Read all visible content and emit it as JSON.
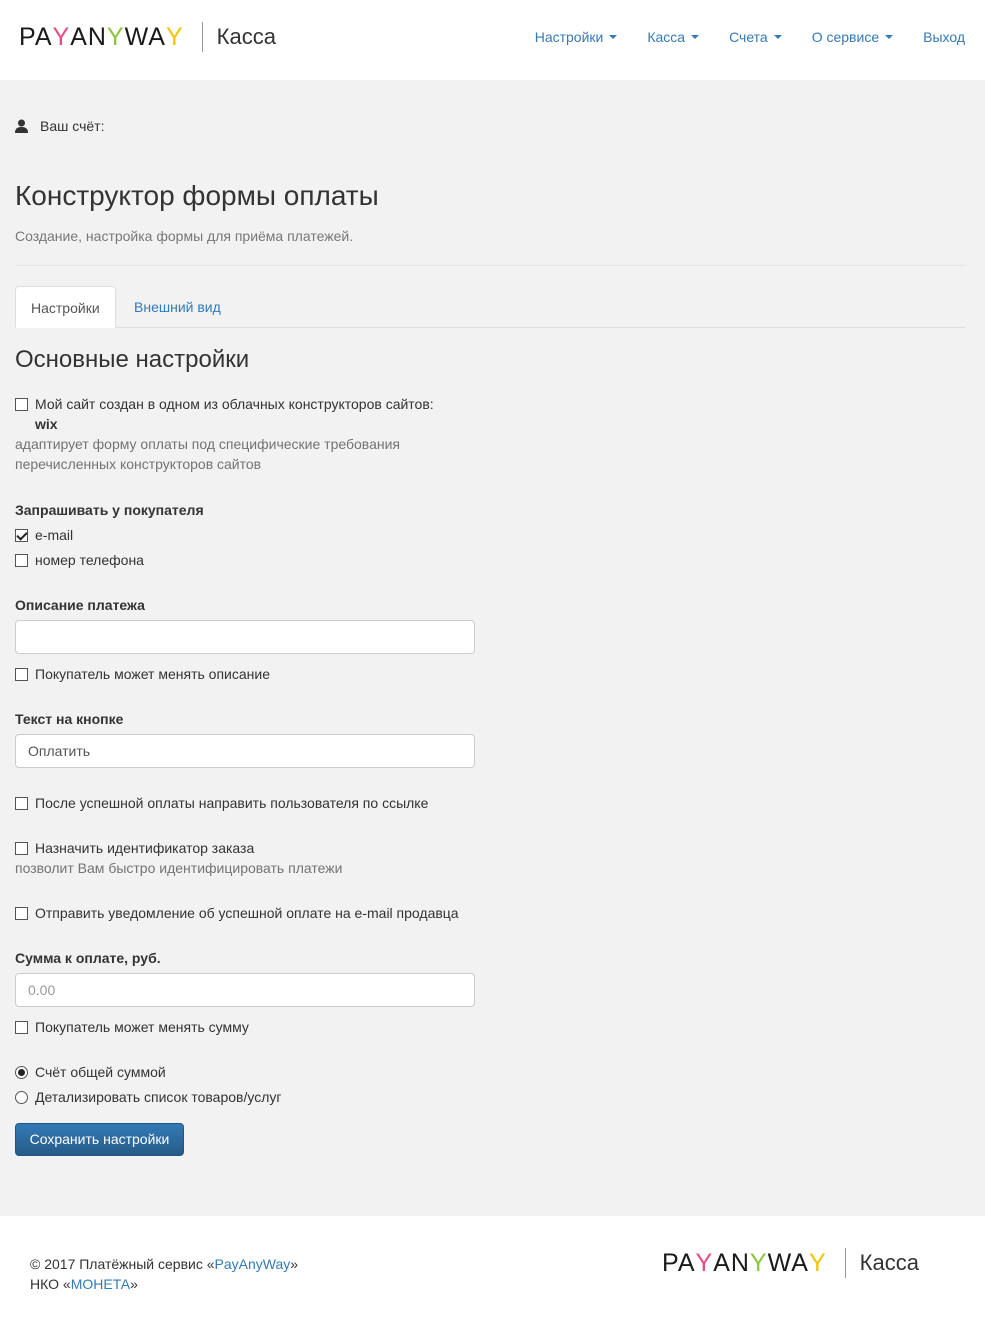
{
  "header": {
    "logo_text": "PAYANYWAY",
    "app_name": "Касса",
    "nav": [
      {
        "label": "Настройки",
        "dropdown": true
      },
      {
        "label": "Касса",
        "dropdown": true
      },
      {
        "label": "Счета",
        "dropdown": true
      },
      {
        "label": "О сервисе",
        "dropdown": true
      },
      {
        "label": "Выход",
        "dropdown": false
      }
    ]
  },
  "account": {
    "label": "Ваш счёт:",
    "icon": "user-icon"
  },
  "page": {
    "title": "Конструктор формы оплаты",
    "subtitle": "Создание, настройка формы для приёма платежей."
  },
  "tabs": [
    {
      "label": "Настройки",
      "active": true
    },
    {
      "label": "Внешний вид",
      "active": false
    }
  ],
  "form": {
    "section_title": "Основные настройки",
    "cloud_builder": {
      "label": "Мой сайт создан в одном из облачных конструкторов сайтов:",
      "option": "wix",
      "help_line1": "адаптирует форму оплаты под специфические требования",
      "help_line2": "перечисленных конструкторов сайтов",
      "checked": false
    },
    "ask_buyer": {
      "label": "Запрашивать у покупателя",
      "email": {
        "label": "e-mail",
        "checked": true
      },
      "phone": {
        "label": "номер телефона",
        "checked": false
      }
    },
    "description": {
      "label": "Описание платежа",
      "value": "",
      "editable_label": "Покупатель может менять описание",
      "editable_checked": false
    },
    "button_text": {
      "label": "Текст на кнопке",
      "value": "Оплатить"
    },
    "redirect": {
      "label": "После успешной оплаты направить пользователя по ссылке",
      "checked": false
    },
    "order_id": {
      "label": "Назначить идентификатор заказа",
      "help": "позволит Вам быстро идентифицировать платежи",
      "checked": false
    },
    "notify": {
      "label": "Отправить уведомление об успешной оплате на e-mail продавца",
      "checked": false
    },
    "amount": {
      "label": "Сумма к оплате, руб.",
      "placeholder": "0.00",
      "editable_label": "Покупатель может менять сумму",
      "editable_checked": false
    },
    "billing_mode": {
      "total_label": "Счёт общей суммой",
      "detailed_label": "Детализировать список товаров/услуг",
      "selected": "total"
    },
    "save_label": "Сохранить настройки"
  },
  "footer": {
    "copyright_prefix": "© 2017 Платёжный сервис «",
    "service_link": "PayAnyWay",
    "copyright_suffix": "»",
    "nko_prefix": "НКО «",
    "nko_link": "МОНЕТА",
    "nko_suffix": "»",
    "logo_text": "PAYANYWAY",
    "app_name": "Касса"
  },
  "colors": {
    "link": "#337ab7",
    "primary_button": "#337ab7",
    "background": "#f2f2f2",
    "logo_y_pink": "#e94a8a",
    "logo_y_green": "#8dc63f",
    "logo_y_yellow": "#f5c400"
  }
}
